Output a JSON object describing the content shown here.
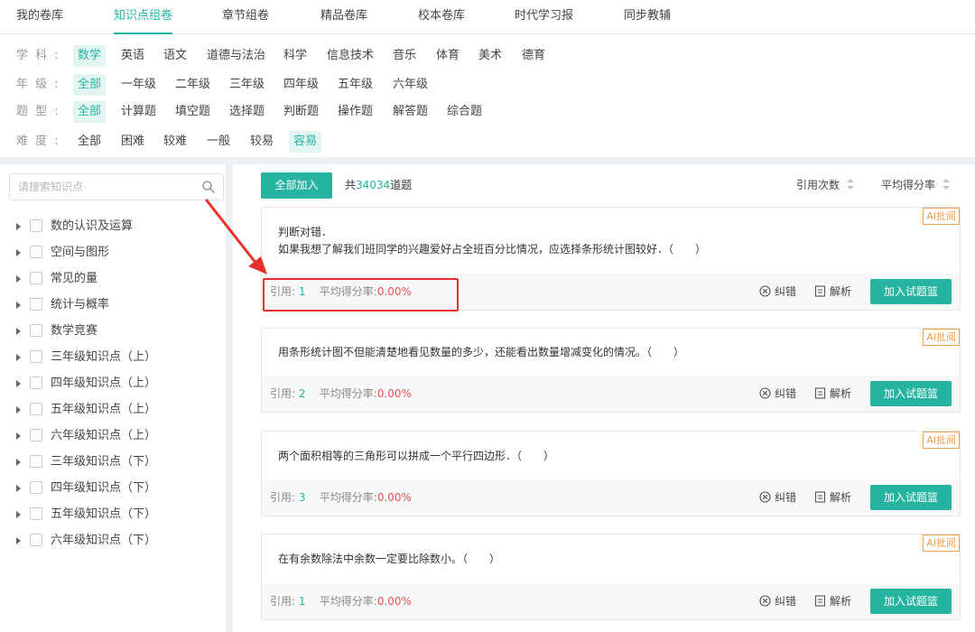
{
  "topnav": {
    "tabs": [
      {
        "label": "我的卷库"
      },
      {
        "label": "知识点组卷"
      },
      {
        "label": "章节组卷"
      },
      {
        "label": "精品卷库"
      },
      {
        "label": "校本卷库"
      },
      {
        "label": "时代学习报"
      },
      {
        "label": "同步教辅"
      }
    ],
    "active_index": 1
  },
  "filters": {
    "subject": {
      "label": "学 科 :",
      "options": [
        "数学",
        "英语",
        "语文",
        "道德与法治",
        "科学",
        "信息技术",
        "音乐",
        "体育",
        "美术",
        "德育"
      ],
      "selected": "数学"
    },
    "grade": {
      "label": "年 级 :",
      "options": [
        "全部",
        "一年级",
        "二年级",
        "三年级",
        "四年级",
        "五年级",
        "六年级"
      ],
      "selected": "全部"
    },
    "qtype": {
      "label": "题 型 :",
      "options": [
        "全部",
        "计算题",
        "填空题",
        "选择题",
        "判断题",
        "操作题",
        "解答题",
        "综合题"
      ],
      "selected": "全部"
    },
    "difficulty": {
      "label": "难 度 :",
      "options": [
        "全部",
        "困难",
        "较难",
        "一般",
        "较易",
        "容易"
      ],
      "selected": "容易"
    }
  },
  "sidebar": {
    "search_placeholder": "请搜索知识点",
    "tree": [
      {
        "label": "数的认识及运算"
      },
      {
        "label": "空间与图形"
      },
      {
        "label": "常见的量"
      },
      {
        "label": "统计与概率"
      },
      {
        "label": "数学竞赛"
      },
      {
        "label": "三年级知识点（上）"
      },
      {
        "label": "四年级知识点（上）"
      },
      {
        "label": "五年级知识点（上）"
      },
      {
        "label": "六年级知识点（上）"
      },
      {
        "label": "三年级知识点（下）"
      },
      {
        "label": "四年级知识点（下）"
      },
      {
        "label": "五年级知识点（下）"
      },
      {
        "label": "六年级知识点（下）"
      }
    ]
  },
  "main": {
    "add_all_label": "全部加入",
    "total_prefix": "共",
    "total_count": "34034",
    "total_suffix": "道题",
    "sort_citations": "引用次数",
    "sort_avg_score": "平均得分率",
    "questions": [
      {
        "lines": [
          "判断对错．",
          "如果我想了解我们班同学的兴趣爱好占全班百分比情况，应选择条形统计图较好．（　　）"
        ],
        "badge": "AI批阅",
        "cite_label": "引用: ",
        "cite_count": "1",
        "rate_label": "平均得分率:",
        "rate_value": "0.00%",
        "correct_label": "纠错",
        "analysis_label": "解析",
        "add_label": "加入试题篮"
      },
      {
        "lines": [
          "用条形统计图不但能清楚地看见数量的多少，还能看出数量增减变化的情况。（　　）"
        ],
        "badge": "AI批阅",
        "cite_label": "引用: ",
        "cite_count": "2",
        "rate_label": "平均得分率:",
        "rate_value": "0.00%",
        "correct_label": "纠错",
        "analysis_label": "解析",
        "add_label": "加入试题篮"
      },
      {
        "lines": [
          "两个面积相等的三角形可以拼成一个平行四边形．（　　）"
        ],
        "badge": "AI批阅",
        "cite_label": "引用: ",
        "cite_count": "3",
        "rate_label": "平均得分率:",
        "rate_value": "0.00%",
        "correct_label": "纠错",
        "analysis_label": "解析",
        "add_label": "加入试题篮"
      },
      {
        "lines": [
          "在有余数除法中余数一定要比除数小。（　　）"
        ],
        "badge": "AI批阅",
        "cite_label": "引用: ",
        "cite_count": "1",
        "rate_label": "平均得分率:",
        "rate_value": "0.00%",
        "correct_label": "纠错",
        "analysis_label": "解析",
        "add_label": "加入试题篮"
      }
    ]
  },
  "colors": {
    "accent": "#26b3a0",
    "rate": "#e45454",
    "badge": "#f0a050",
    "annotation": "#e8312f"
  }
}
